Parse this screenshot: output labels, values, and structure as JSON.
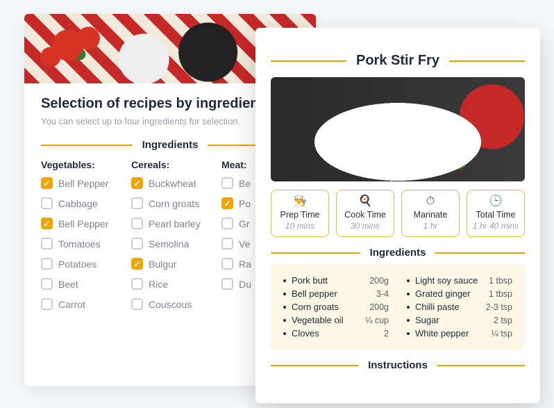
{
  "selector": {
    "title": "Selection of recipes by ingredients",
    "subtitle": "You can select up to four ingredients for selection.",
    "section_label": "Ingredients",
    "columns": [
      {
        "title": "Vegetables:",
        "items": [
          {
            "label": "Bell Pepper",
            "checked": true
          },
          {
            "label": "Cabbage",
            "checked": false
          },
          {
            "label": "Bell Pepper",
            "checked": true
          },
          {
            "label": "Tomatoes",
            "checked": false
          },
          {
            "label": "Potatoes",
            "checked": false
          },
          {
            "label": "Beet",
            "checked": false
          },
          {
            "label": "Carrot",
            "checked": false
          }
        ]
      },
      {
        "title": "Cereals:",
        "items": [
          {
            "label": "Buckwheat",
            "checked": true
          },
          {
            "label": "Corn groats",
            "checked": false
          },
          {
            "label": "Pearl barley",
            "checked": false
          },
          {
            "label": "Semolina",
            "checked": false
          },
          {
            "label": "Bulgur",
            "checked": true
          },
          {
            "label": "Rice",
            "checked": false
          },
          {
            "label": "Couscous",
            "checked": false
          }
        ]
      },
      {
        "title": "Meat:",
        "items": [
          {
            "label": "Be",
            "checked": false
          },
          {
            "label": "Po",
            "checked": true
          },
          {
            "label": "Gr",
            "checked": false
          },
          {
            "label": "Ve",
            "checked": false
          },
          {
            "label": "Ra",
            "checked": false
          },
          {
            "label": "Du",
            "checked": false
          }
        ]
      }
    ]
  },
  "recipe": {
    "title": "Pork Stir Fry",
    "times": [
      {
        "icon": "chef-hat-icon",
        "glyph": "👨‍🍳",
        "label": "Prep Time",
        "value": "10 mins"
      },
      {
        "icon": "pot-icon",
        "glyph": "🍳",
        "label": "Cook Time",
        "value": "30 mins"
      },
      {
        "icon": "timer-icon",
        "glyph": "⏱",
        "label": "Marinate",
        "value": "1 hr"
      },
      {
        "icon": "clock-icon",
        "glyph": "🕒",
        "label": "Total Time",
        "value": "1 hr 40 mins"
      }
    ],
    "ingredients_label": "Ingredients",
    "ingredients_left": [
      {
        "name": "Pork butt",
        "amt": "200g"
      },
      {
        "name": "Bell pepper",
        "amt": "3-4"
      },
      {
        "name": "Corn groats",
        "amt": "200g"
      },
      {
        "name": "Vegetable oil",
        "amt": "¼ cup"
      },
      {
        "name": "Cloves",
        "amt": "2"
      }
    ],
    "ingredients_right": [
      {
        "name": "Light soy sauce",
        "amt": "1 tbsp"
      },
      {
        "name": "Grated ginger",
        "amt": "1 tbsp"
      },
      {
        "name": "Chilli paste",
        "amt": "2-3 tsp"
      },
      {
        "name": "Sugar",
        "amt": "2 tsp"
      },
      {
        "name": "White pepper",
        "amt": "¼ tsp"
      }
    ],
    "instructions_label": "Instructions"
  }
}
